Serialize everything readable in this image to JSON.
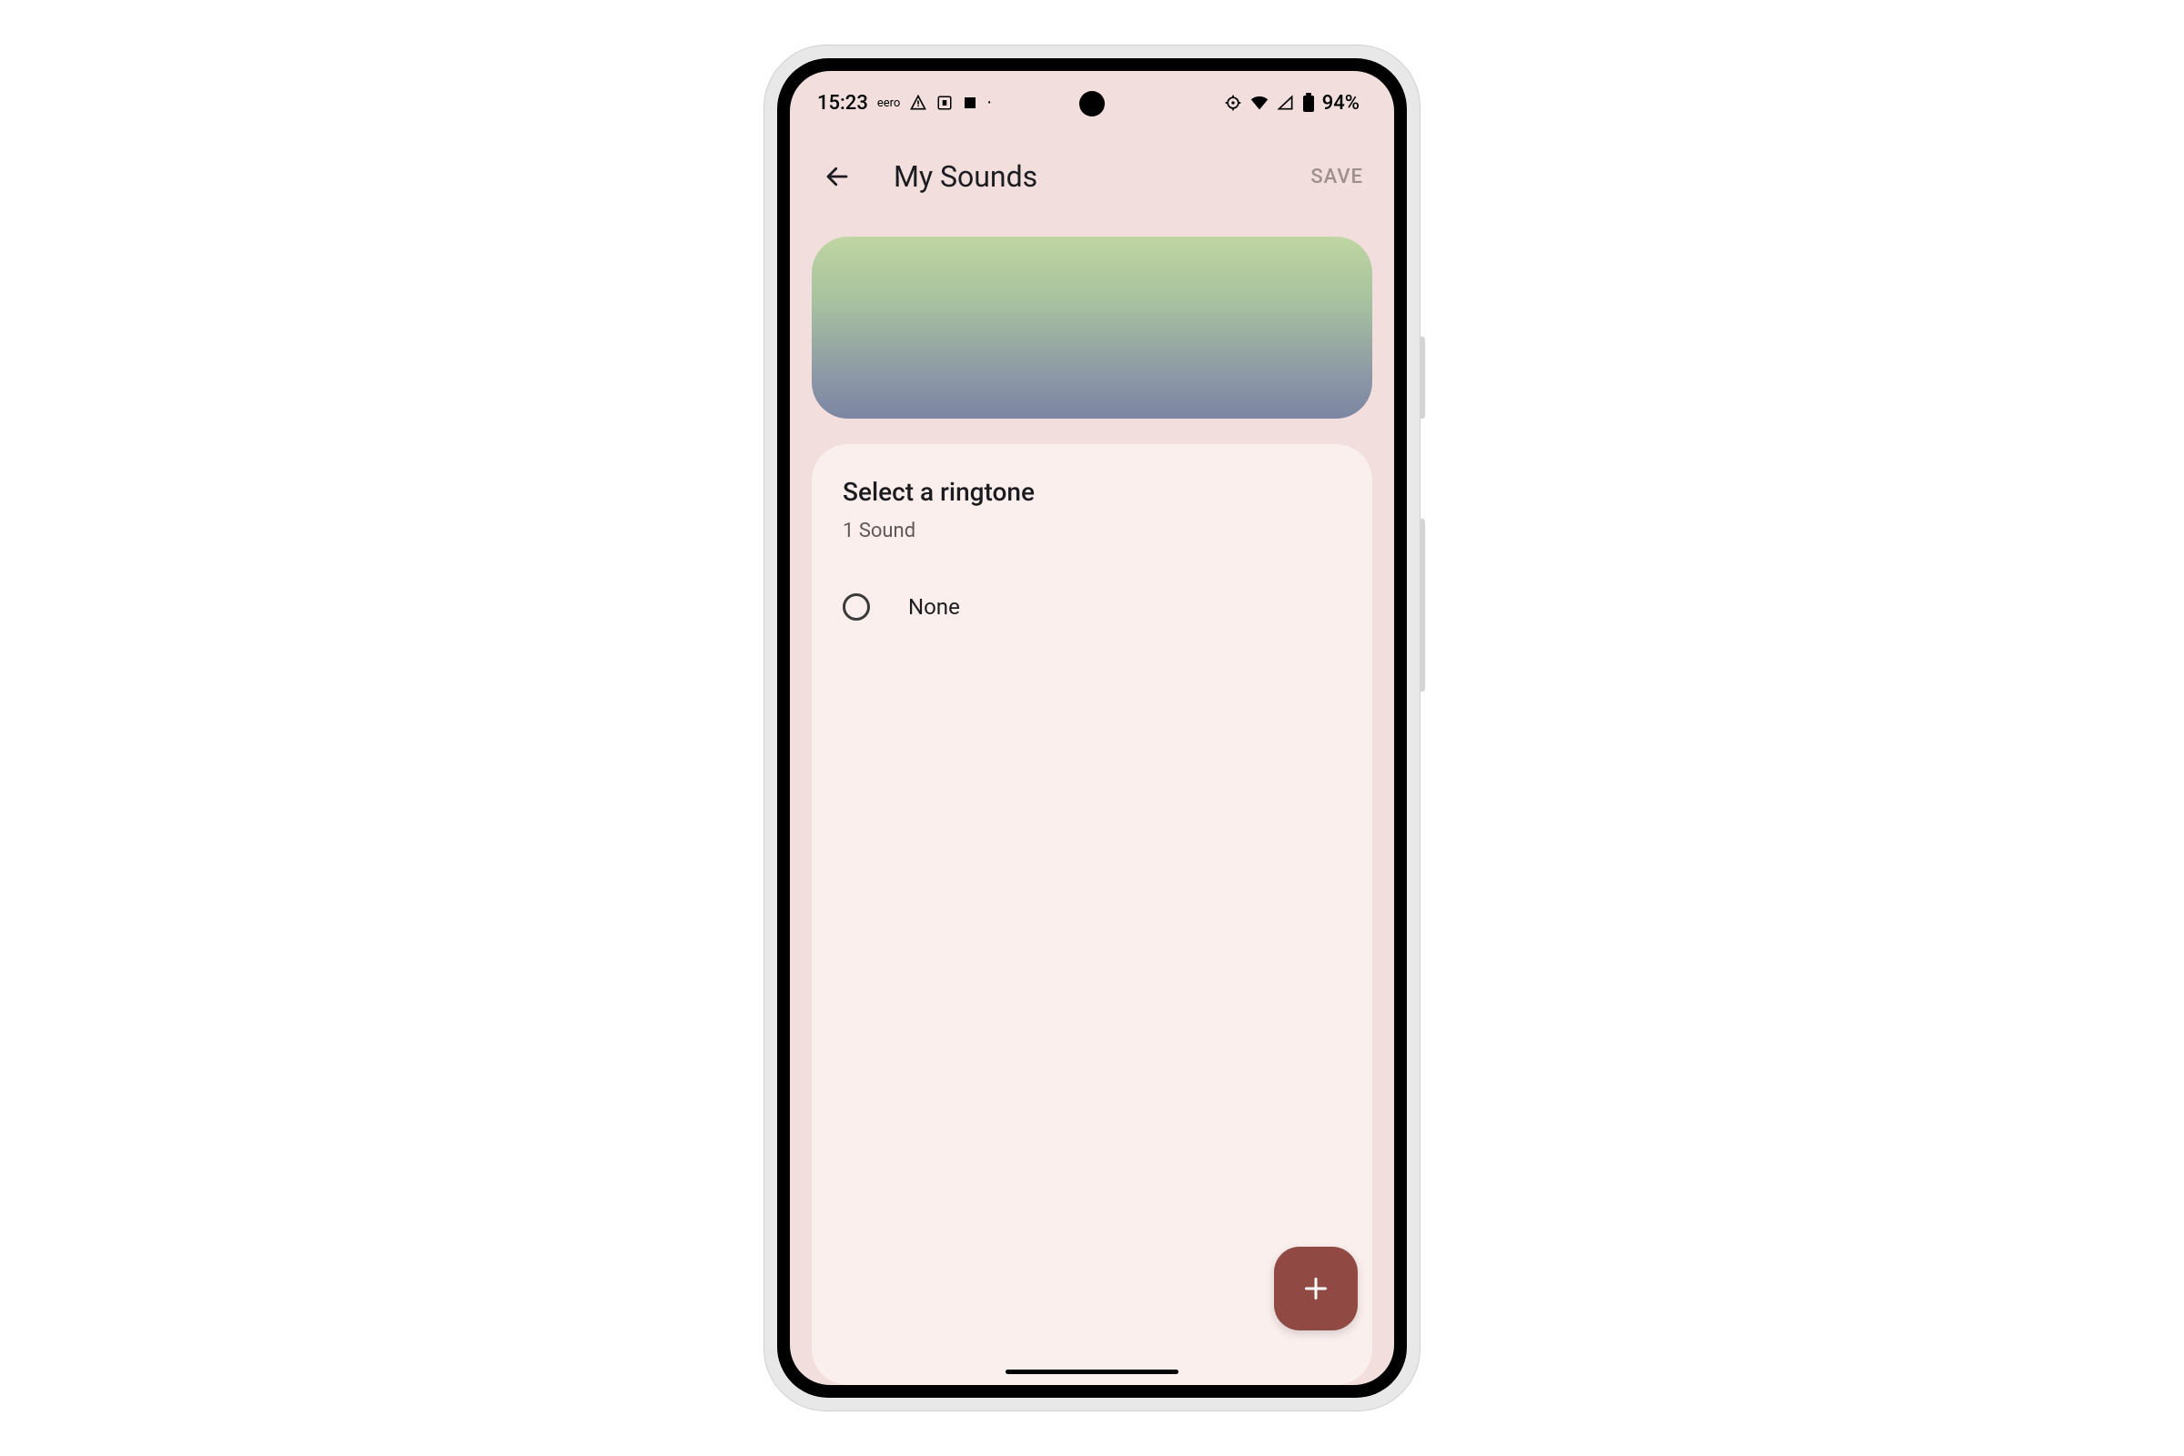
{
  "status": {
    "time": "15:23",
    "carrier": "eero",
    "battery_text": "94%"
  },
  "appbar": {
    "title": "My Sounds",
    "save_label": "SAVE"
  },
  "list": {
    "heading": "Select a ringtone",
    "subheading": "1 Sound",
    "items": [
      {
        "label": "None",
        "selected": false
      }
    ]
  },
  "colors": {
    "background": "#f1dedd",
    "card": "#fbefee",
    "fab": "#914a43"
  }
}
